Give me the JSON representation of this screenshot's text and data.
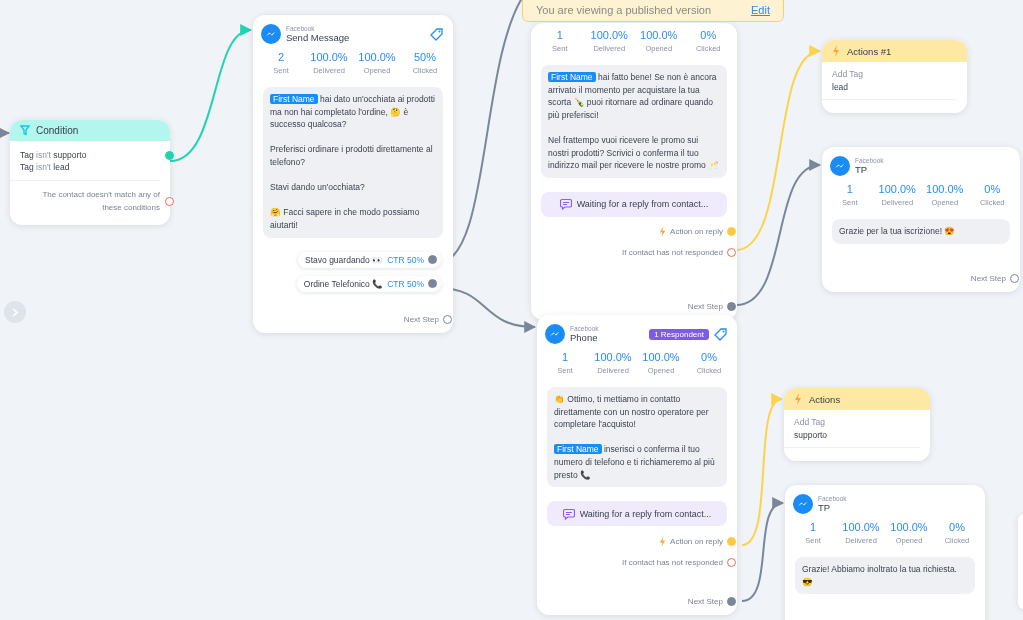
{
  "banner": {
    "text": "You are viewing a published version",
    "link": "Edit"
  },
  "nodes": [
    {
      "kind": "condition",
      "title": "Condition",
      "rules": [
        {
          "subject": "Tag",
          "operator": "isn't",
          "value": "supporto"
        },
        {
          "subject": "Tag",
          "operator": "isn't",
          "value": "lead"
        }
      ],
      "match_connected": true,
      "fallback": {
        "label": "The contact doesn't match any of these conditions",
        "connected": false
      }
    },
    {
      "kind": "message",
      "platform": "Facebook",
      "title": "Send Message",
      "stats": [
        {
          "value": "2",
          "label": "Sent"
        },
        {
          "value": "100.0%",
          "label": "Delivered"
        },
        {
          "value": "100.0%",
          "label": "Opened"
        },
        {
          "value": "50%",
          "label": "Clicked"
        }
      ],
      "message": [
        {
          "kind": "variable",
          "text": "First Name"
        },
        {
          "kind": "text",
          "text": " hai dato un'occhiata ai prodotti ma non hai completato l'ordine, 🤔 è successo qualcosa?\n\nPreferisci ordinare i prodotti direttamente al telefono?\n\nStavi dando un'occhiata?\n\n🤗 Facci sapere in che modo possiamo aiutarti!"
        }
      ],
      "quick_replies": [
        {
          "label": "Stavo guardando 👀",
          "ctr": "CTR 50%",
          "connected": true
        },
        {
          "label": "Ordine Telefonico 📞",
          "ctr": "CTR 50%",
          "connected": true
        }
      ],
      "ports": [
        {
          "kind": "next",
          "label": "Next Step",
          "connected": false
        }
      ]
    },
    {
      "kind": "message",
      "stats": [
        {
          "value": "1",
          "label": "Sent"
        },
        {
          "value": "100.0%",
          "label": "Delivered"
        },
        {
          "value": "100.0%",
          "label": "Opened"
        },
        {
          "value": "0%",
          "label": "Clicked"
        }
      ],
      "message": [
        {
          "kind": "variable",
          "text": "First Name"
        },
        {
          "kind": "text",
          "text": " hai fatto bene! Se non è ancora arrivato il momento per acquistare la tua scorta 🍾 puoi ritornare ad ordinare quando più preferisci!\n\nNel frattempo vuoi ricevere le promo sui nostri prodotti? Scrivici o conferma il tuo indirizzo mail per ricevere le nostre promo 🥂"
        }
      ],
      "waiting": "Waiting for a reply from contact...",
      "ports": [
        {
          "kind": "reply",
          "label": "Action on reply",
          "connected": true
        },
        {
          "kind": "no_response",
          "label": "If contact has not responded",
          "connected": false
        },
        {
          "kind": "next",
          "label": "Next Step",
          "connected": true
        }
      ]
    },
    {
      "kind": "action",
      "title": "Actions #1",
      "action": "Add Tag",
      "value": "lead"
    },
    {
      "kind": "message",
      "platform": "Facebook",
      "title": "TP",
      "stats": [
        {
          "value": "1",
          "label": "Sent"
        },
        {
          "value": "100.0%",
          "label": "Delivered"
        },
        {
          "value": "100.0%",
          "label": "Opened"
        },
        {
          "value": "0%",
          "label": "Clicked"
        }
      ],
      "message": [
        {
          "kind": "text",
          "text": "Grazie per la tua iscrizione! 😍"
        }
      ],
      "ports": [
        {
          "kind": "next",
          "label": "Next Step",
          "connected": false
        }
      ]
    },
    {
      "kind": "message",
      "platform": "Facebook",
      "title": "Phone",
      "badge": "1 Respondent",
      "stats": [
        {
          "value": "1",
          "label": "Sent"
        },
        {
          "value": "100.0%",
          "label": "Delivered"
        },
        {
          "value": "100.0%",
          "label": "Opened"
        },
        {
          "value": "0%",
          "label": "Clicked"
        }
      ],
      "message": [
        {
          "kind": "text",
          "text": "👏 Ottimo, ti mettiamo in contatto direttamente con un nostro operatore per completare l'acquisto!\n\n"
        },
        {
          "kind": "variable",
          "text": "First Name"
        },
        {
          "kind": "text",
          "text": " inserisci o conferma il tuo numero di telefono e ti richiameremo al più presto 📞"
        }
      ],
      "waiting": "Waiting for a reply from contact...",
      "ports": [
        {
          "kind": "reply",
          "label": "Action on reply",
          "connected": true
        },
        {
          "kind": "no_response",
          "label": "If contact has not responded",
          "connected": false
        },
        {
          "kind": "next",
          "label": "Next Step",
          "connected": true
        }
      ]
    },
    {
      "kind": "action",
      "title": "Actions",
      "action": "Add Tag",
      "value": "supporto"
    },
    {
      "kind": "message",
      "platform": "Facebook",
      "title": "TP",
      "stats": [
        {
          "value": "1",
          "label": "Sent"
        },
        {
          "value": "100.0%",
          "label": "Delivered"
        },
        {
          "value": "100.0%",
          "label": "Opened"
        },
        {
          "value": "0%",
          "label": "Clicked"
        }
      ],
      "message": [
        {
          "kind": "text",
          "text": "Grazie! Abbiamo inoltrato la tua richiesta. 😎"
        }
      ]
    }
  ]
}
